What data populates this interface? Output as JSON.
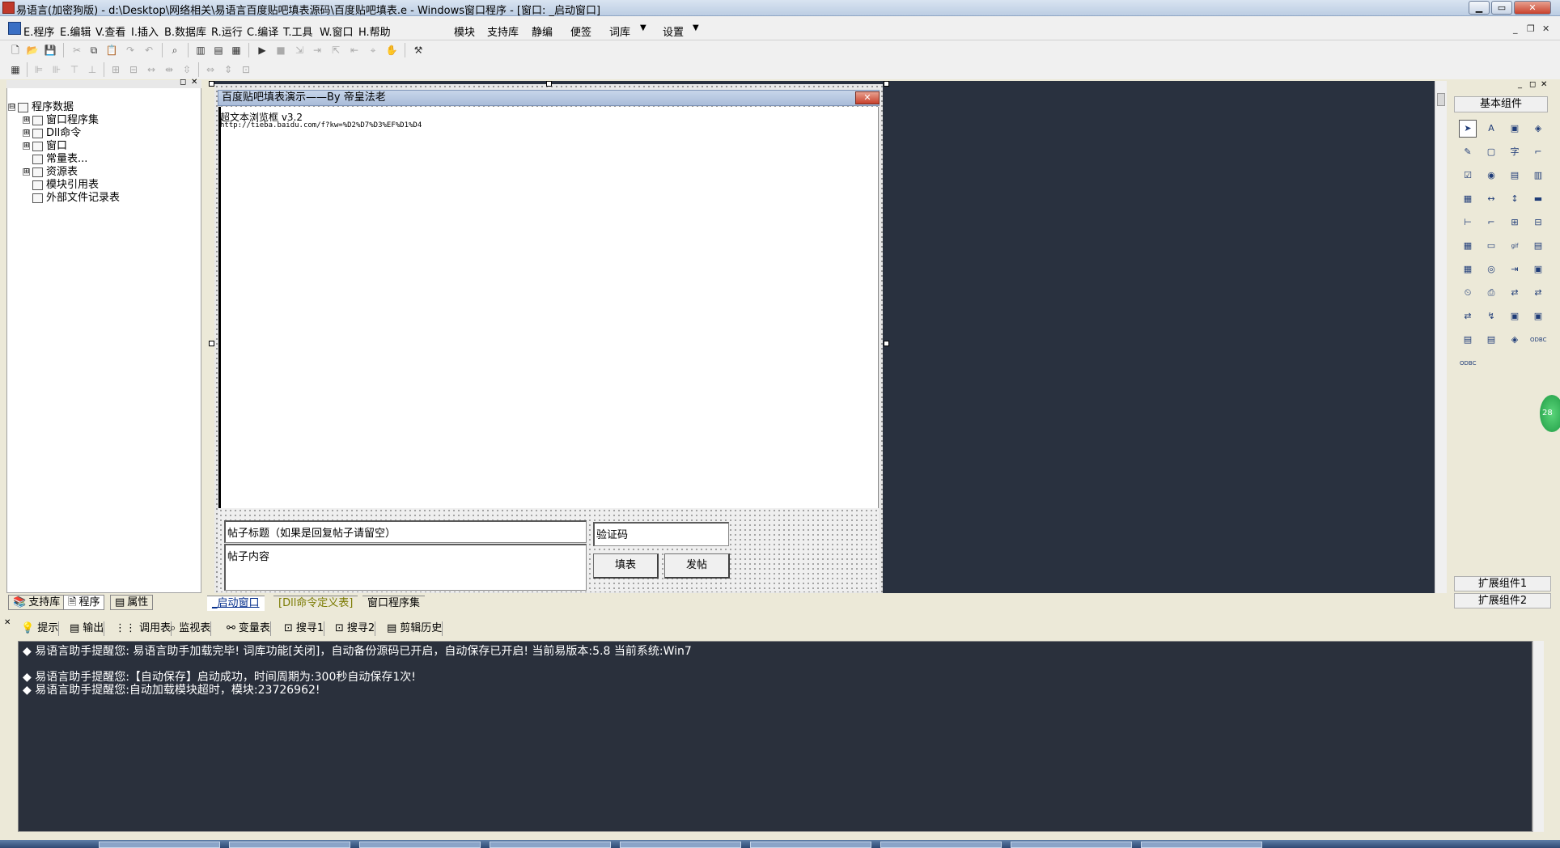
{
  "window": {
    "title": "易语言(加密狗版) - d:\\Desktop\\网络相关\\易语言百度贴吧填表源码\\百度贴吧填表.e - Windows窗口程序 - [窗口: _启动窗口]",
    "controls": [
      "▁",
      "▭",
      "✕"
    ]
  },
  "menu": {
    "items": [
      "E.程序",
      "E.编辑",
      "V.查看",
      "I.插入",
      "B.数据库",
      "R.运行",
      "C.编译",
      "T.工具",
      "W.窗口",
      "H.帮助",
      "模块",
      "支持库",
      "静编",
      "便签",
      "词库",
      "设置"
    ],
    "dropdown_arrows": [
      "▼",
      "▼"
    ],
    "mdi_controls": [
      "_",
      "❐",
      "✕"
    ]
  },
  "left_panel": {
    "header_controls": [
      "◻",
      "✕"
    ],
    "tree": [
      {
        "label": "程序数据",
        "level": 0,
        "expander": "⊟"
      },
      {
        "label": "窗口程序集",
        "level": 1,
        "expander": "⊞"
      },
      {
        "label": "Dll命令",
        "level": 1,
        "expander": "⊞"
      },
      {
        "label": "窗口",
        "level": 1,
        "expander": "⊞"
      },
      {
        "label": "常量表...",
        "level": 1,
        "expander": ""
      },
      {
        "label": "资源表",
        "level": 1,
        "expander": "⊞"
      },
      {
        "label": "模块引用表",
        "level": 1,
        "expander": ""
      },
      {
        "label": "外部文件记录表",
        "level": 1,
        "expander": ""
      }
    ],
    "tabs": [
      "支持库",
      "程序",
      "属性"
    ]
  },
  "form": {
    "title": "百度贴吧填表演示——By 帝皇法老",
    "close": "✕",
    "browser_line1": "超文本浏览框 v3.2",
    "browser_line2": "http://tieba.baidu.com/f?kw=%D2%D7%D3%EF%D1%D4",
    "post_title_value": "帖子标题（如果是回复帖子请留空）",
    "post_content_value": "帖子内容",
    "captcha_value": "验证码",
    "fill_button": "填表",
    "post_button": "发帖"
  },
  "doc_tabs": [
    "_启动窗口",
    "[Dll命令定义表]",
    "窗口程序集"
  ],
  "right_panel": {
    "header_controls": [
      "_",
      "◻",
      "✕"
    ],
    "title": "基本组件",
    "ext1": "扩展组件1",
    "ext2": "扩展组件2",
    "components": [
      "➤",
      "A",
      "▣",
      "◈",
      "✎",
      "▢",
      "字",
      "⌐",
      "☑",
      "◉",
      "▤",
      "▥",
      "▦",
      "↔",
      "↕",
      "▬",
      "⊢",
      "⌐",
      "⊞",
      "⊟",
      "▦",
      "▭",
      "gif",
      "▤",
      "▦",
      "◎",
      "⇥",
      "▣",
      "⏲",
      "⎙",
      "⇄",
      "⇄",
      "⇄",
      "↯",
      "▣",
      "▣",
      "▤",
      "▤",
      "◈",
      "ODBC",
      "ODBC"
    ]
  },
  "output_tabs": [
    "提示",
    "输出",
    "调用表",
    "监视表",
    "变量表",
    "搜寻1",
    "搜寻2",
    "剪辑历史"
  ],
  "output_lines": [
    "◆ 易语言助手提醒您:  易语言助手加载完毕!  词库功能[关闭]，自动备份源码已开启，自动保存已开启!  当前易版本:5.8  当前系统:Win7",
    "◆ 易语言助手提醒您:【自动保存】启动成功，时间周期为:300秒自动保存1次!",
    "◆ 易语言助手提醒您:自动加载模块超时，模块:23726962!"
  ],
  "floating_badge": "28"
}
